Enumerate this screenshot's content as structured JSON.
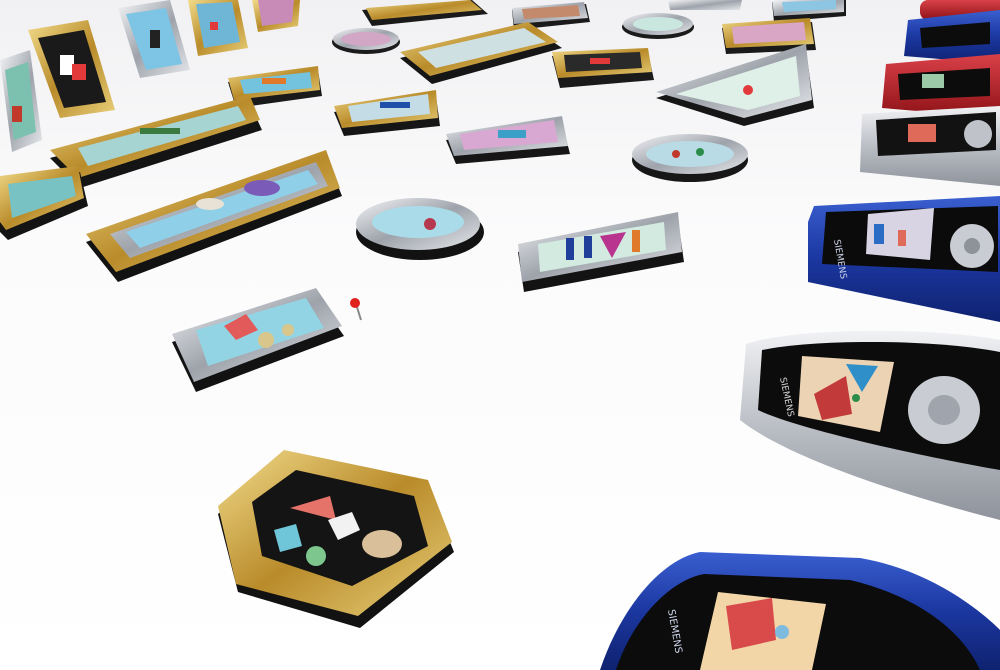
{
  "scene": {
    "kind": "photo",
    "subject": "miniature picture frames and mobile phones",
    "background": "#f7f7f8"
  },
  "colors": {
    "gold": "#c9a13b",
    "silver": "#c7cbd1",
    "frame_dark": "#1c1c1e",
    "screen_blue": "#bfe3ea",
    "phone_blue": "#1f3ea8",
    "phone_red": "#b21f24",
    "phone_silver": "#c9ccd2",
    "pin_red": "#e0201c"
  },
  "phones": [
    {
      "brand": "SIEMENS",
      "color": "blue"
    },
    {
      "brand": "SIEMENS",
      "color": "silver"
    },
    {
      "brand": "SIEMENS",
      "color": "blue"
    }
  ]
}
